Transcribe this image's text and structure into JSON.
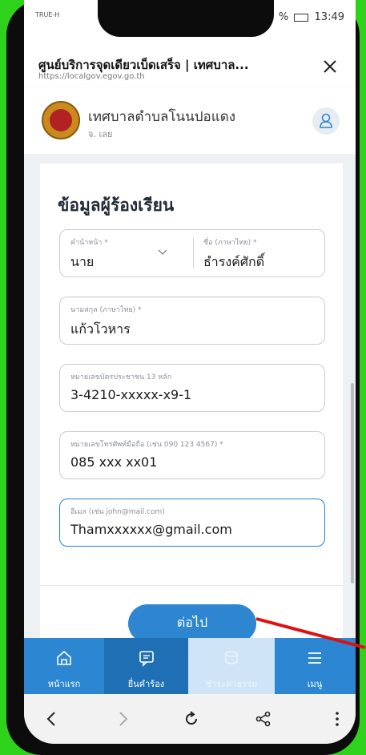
{
  "status": {
    "carrier": "TRUE-H",
    "time": "13:49",
    "battery": "%"
  },
  "browser": {
    "title": "ศูนย์บริการจุดเดียวเบ็ดเสร็จ | เทศบาล...",
    "url": "https://localgov.egov.go.th"
  },
  "org": {
    "name": "เทศบาลตำบลโนนปอแดง",
    "province": "จ. เลย"
  },
  "form": {
    "section_title": "ข้อมูลผู้ร้องเรียน",
    "prefix": {
      "label": "คำนำหน้า *",
      "value": "นาย"
    },
    "firstname": {
      "label": "ชื่อ (ภาษาไทย) *",
      "value": "ธำรงค์ศักดิ์"
    },
    "lastname": {
      "label": "นามสกุล (ภาษาไทย) *",
      "value": "แก้วโวหาร"
    },
    "idcard": {
      "label": "หมายเลขบัตรประชาชน 13 หลัก",
      "value": "3-4210-xxxxx-x9-1"
    },
    "phone": {
      "label": "หมายเลขโทรศัพท์มือถือ (เช่น 090 123 4567) *",
      "value": "085 xxx xx01"
    },
    "email": {
      "label": "อีเมล (เช่น john@mail.com)",
      "value": "Thamxxxxxx@gmail.com"
    },
    "next_label": "ต่อไป"
  },
  "nav": {
    "home": "หน้าแรก",
    "submit": "ยื่นคำร้อง",
    "pay": "ชำระค่าธรรม",
    "menu": "เมนู"
  },
  "colors": {
    "accent": "#2e86d0",
    "background": "#2fd21a",
    "arrow": "#e01010"
  }
}
